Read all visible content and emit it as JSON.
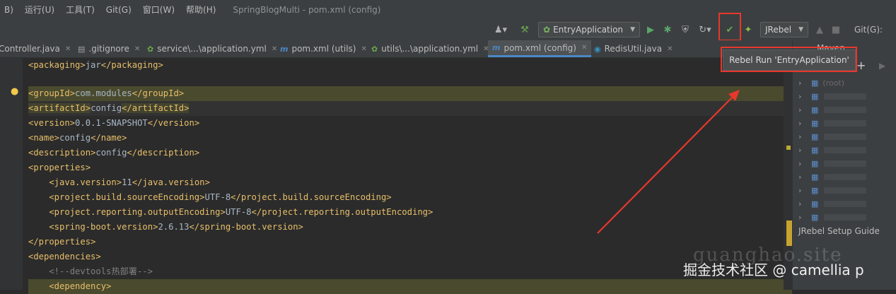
{
  "menubar": {
    "items": [
      "B)",
      "运行(U)",
      "工具(T)",
      "Git(G)",
      "窗口(W)",
      "帮助(H)"
    ],
    "window_title": "SpringBlogMulti - pom.xml (config)"
  },
  "toolbar": {
    "run_config": "EntryApplication",
    "jrebel_select": "JRebel",
    "git_label": "Git(G):"
  },
  "tooltip": {
    "text": "Rebel Run 'EntryApplication'"
  },
  "tabs": [
    {
      "label": "Controller.java",
      "icon": "class-icon"
    },
    {
      "label": ".gitignore",
      "icon": "file-icon"
    },
    {
      "label": "service\\...\\application.yml",
      "icon": "leaf-icon"
    },
    {
      "label": "pom.xml (utils)",
      "icon": "maven-icon"
    },
    {
      "label": "utils\\...\\application.yml",
      "icon": "leaf-icon"
    },
    {
      "label": "pom.xml (config)",
      "icon": "maven-icon",
      "active": true
    },
    {
      "label": "RedisUtil.java",
      "icon": "class-icon"
    }
  ],
  "editor": {
    "lines": [
      {
        "open": "<packaging>",
        "text": "jar",
        "close": "</packaging>"
      },
      {
        "open": "",
        "text": "",
        "close": ""
      },
      {
        "open": "<groupId>",
        "text": "com.modules",
        "close": "</groupId>"
      },
      {
        "open": "<artifactId>",
        "text": "config",
        "close": "</artifactId>"
      },
      {
        "open": "<version>",
        "text": "0.0.1-SNAPSHOT",
        "close": "</version>"
      },
      {
        "open": "<name>",
        "text": "config",
        "close": "</name>"
      },
      {
        "open": "<description>",
        "text": "config",
        "close": "</description>"
      },
      {
        "open": "<properties>",
        "text": "",
        "close": ""
      },
      {
        "open": "    <java.version>",
        "text": "11",
        "close": "</java.version>"
      },
      {
        "open": "    <project.build.sourceEncoding>",
        "text": "UTF-8",
        "close": "</project.build.sourceEncoding>"
      },
      {
        "open": "    <project.reporting.outputEncoding>",
        "text": "UTF-8",
        "close": "</project.reporting.outputEncoding>"
      },
      {
        "open": "    <spring-boot.version>",
        "text": "2.6.13",
        "close": "</spring-boot.version>"
      },
      {
        "open": "</properties>",
        "text": "",
        "close": ""
      },
      {
        "open": "<dependencies>",
        "text": "",
        "close": ""
      },
      {
        "open": "",
        "text": "    <!--devtools热部署-->",
        "close": ""
      },
      {
        "open": "    <dependency>",
        "text": "",
        "close": ""
      }
    ]
  },
  "maven": {
    "title": "Maven",
    "root_hint": "(root)",
    "setup_guide": "JRebel Setup Guide"
  },
  "watermark": {
    "text": "掘金技术社区 @ camellia p",
    "faint": "guanghao.site"
  },
  "colors": {
    "highlight_red": "#e8372c",
    "accent_blue": "#4a88c7",
    "tag_yellow": "#e8bf6a"
  }
}
